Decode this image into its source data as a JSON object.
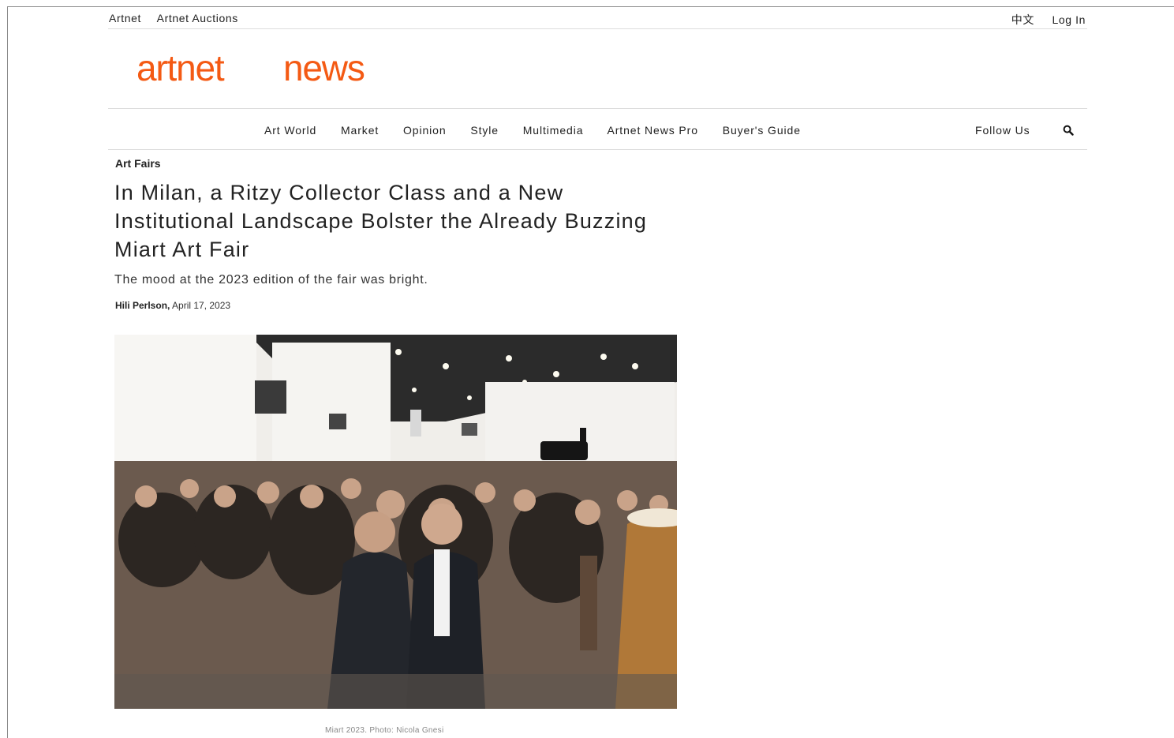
{
  "topbar": {
    "links": [
      "Artnet",
      "Artnet Auctions"
    ],
    "language": "中文",
    "login": "Log In"
  },
  "logo": {
    "part1": "artnet",
    "part2": "news",
    "color": "#f45a14"
  },
  "nav": {
    "items": [
      "Art World",
      "Market",
      "Opinion",
      "Style",
      "Multimedia",
      "Artnet News Pro",
      "Buyer's Guide"
    ],
    "follow": "Follow Us",
    "search_icon": "search-icon"
  },
  "article": {
    "category": "Art Fairs",
    "title": "In Milan, a Ritzy Collector Class and a New Institutional Landscape Bolster the Already Buzzing Miart Art Fair",
    "subtitle": "The mood at the 2023 edition of the fair was bright.",
    "author": "Hili Perlson,",
    "date": "April 17, 2023",
    "image_caption": "Miart 2023. Photo: Nicola Gnesi"
  }
}
